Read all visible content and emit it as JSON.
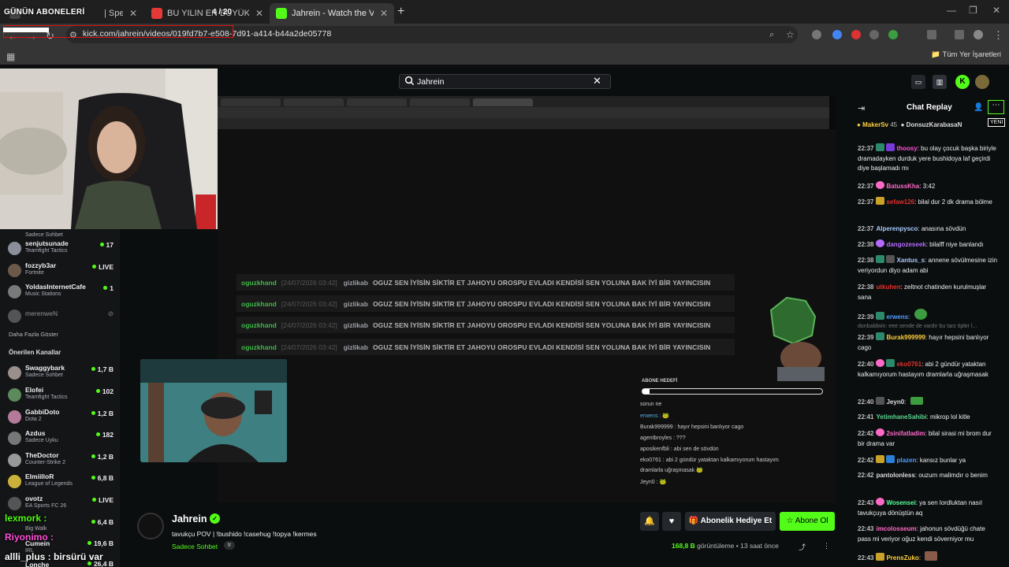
{
  "browser": {
    "tabs": [
      {
        "title": "| Special Dance",
        "active": false
      },
      {
        "title": "BU YILIN EN BÜYÜK DRAMASI",
        "active": false
      },
      {
        "title": "Jahrein - Watch the VOD on",
        "active": true
      }
    ],
    "url": "kick.com/jahrein/videos/019fd7b7-e508-7d91-a414-b44a2de05778",
    "bookmarks_all": "Tüm Yer İşaretleri"
  },
  "overlay": {
    "title": "GÜNÜN ABONELERİ",
    "counter": "4 / 20"
  },
  "search": {
    "value": "Jahrein"
  },
  "sidebar": {
    "followed": [
      {
        "name": "",
        "category": "Sadece Sohbet",
        "count": ""
      },
      {
        "name": "senjutsunade",
        "category": "Teamfight Tactics",
        "count": "17"
      },
      {
        "name": "fozzyb3ar",
        "category": "Fortnite",
        "count": "LIVE"
      },
      {
        "name": "YoldasInternetCafe",
        "category": "Music Stations",
        "count": "1"
      },
      {
        "name": "merenweN",
        "category": "",
        "count": ""
      }
    ],
    "show_more": "Daha Fazla Göster",
    "recommended_heading": "Önerilen Kanallar",
    "recommended": [
      {
        "name": "Swaggybark",
        "category": "Sadece Sohbet",
        "count": "1,7 B"
      },
      {
        "name": "Elofei",
        "category": "Teamfight Tactics",
        "count": "102"
      },
      {
        "name": "GabbiDoto",
        "category": "Dota 2",
        "count": "1,2 B"
      },
      {
        "name": "Azdus",
        "category": "Sadece Uyku",
        "count": "182"
      },
      {
        "name": "TheDoctor",
        "category": "Counter-Strike 2",
        "count": "1,2 B"
      },
      {
        "name": "ElmiilloR",
        "category": "League of Legends",
        "count": "6,8 B"
      },
      {
        "name": "ovotz",
        "category": "EA Sports FC 26",
        "count": "LIVE"
      },
      {
        "name": "",
        "category": "Big Walk",
        "count": "6,4 B"
      },
      {
        "name": "Cumein",
        "category": "IRL",
        "count": "19,6 B"
      },
      {
        "name": "Lonche",
        "category": "",
        "count": "26,4 B"
      }
    ]
  },
  "video": {
    "repeated_messages": [
      {
        "user": "oguzkhand",
        "time": "[24/07/2026 03:42]",
        "author": "gizlikab",
        "text": "OGUZ SEN İYİSİN SİKTİR ET JAHOYU OROSPU EVLADI KENDİSİ SEN YOLUNA BAK İYİ BİR YAYINCISIN"
      },
      {
        "user": "oguzkhand",
        "time": "[24/07/2026 03:42]",
        "author": "gizlikab",
        "text": "OGUZ SEN İYİSİN SİKTİR ET JAHOYU OROSPU EVLADI KENDİSİ SEN YOLUNA BAK İYİ BİR YAYINCISIN"
      },
      {
        "user": "oguzkhand",
        "time": "[24/07/2026 03:42]",
        "author": "gizlikab",
        "text": "OGUZ SEN İYİSİN SİKTİR ET JAHOYU OROSPU EVLADI KENDİSİ SEN YOLUNA BAK İYİ BİR YAYINCISIN"
      },
      {
        "user": "oguzkhand",
        "time": "[24/07/2026 03:42]",
        "author": "gizlikab",
        "text": "OGUZ SEN İYİSİN SİKTİR ET JAHOYU OROSPU EVLADI KENDİSİ SEN YOLUNA BAK İYİ BİR YAYINCISIN"
      }
    ],
    "sub_goal_label": "ABONE HEDEFİ",
    "sub_goal_progress": 0.04,
    "inner_chat": [
      "sorun ne",
      "erwens : 🐸",
      "Burak999999 : hayır hepsini banlıyor cago",
      "agentbroyles : ???",
      "aposikenfbli : abi sen de sövdün",
      "eko0761 : abi 2 gündür yataktan kalkamıyorum hastayım",
      "dramlarla uğraşmasak 🐸",
      "Jeyn0 : 🐸"
    ]
  },
  "stream": {
    "channel": "Jahrein",
    "title": "tavukçu POV | !bushido !casehug !topya !kermes",
    "category": "Sadece Sohbet",
    "tag": "tr",
    "gift_label": "Abonelik Hediye Et",
    "subscribe_label": "Abone Ol",
    "viewers": "168,8 B",
    "viewers_label": "görüntüleme",
    "ago": "13 saat önce"
  },
  "overlay_chat": [
    {
      "text": "lexmork :"
    },
    {
      "text": "Riyonimo :"
    },
    {
      "text": "allli_plus : birsürü var"
    }
  ],
  "chat": {
    "title": "Chat Replay",
    "new_label": "YENİ",
    "pinned": [
      {
        "name": "MakerSv",
        "count": "45"
      },
      {
        "name": "DonsuzKarabasaN",
        "count": ""
      }
    ],
    "messages": [
      {
        "time": "22:37",
        "user": "thoosy",
        "color": "#ff4fd8",
        "text": "bu olay çocuk başka biriyle dramadayken durduk yere bushidoya laf geçirdi diye başlamadı mı"
      },
      {
        "time": "22:37",
        "user": "BatussKha",
        "color": "#ff69c8",
        "text": "3:42"
      },
      {
        "time": "22:37",
        "user": "sefaw126",
        "color": "#e0312c",
        "text": "bilal dur 2 dk drama bölme"
      },
      {
        "time": "22:37",
        "user": "Alperenpysco",
        "color": "#a9c9ff",
        "text": "anasına sövdün"
      },
      {
        "time": "22:38",
        "user": "dangozeseek",
        "color": "#b46bff",
        "text": "bilalff niye banlandı"
      },
      {
        "time": "22:38",
        "user": "Xantus_s",
        "color": "#a9c9ff",
        "text": "annene sövülmesine izin veriyordun diyo adam abi"
      },
      {
        "time": "22:38",
        "user": "utkuhen",
        "color": "#e0312c",
        "text": "zeltnot chatinden kurulmuşlar sana"
      },
      {
        "time": "22:39",
        "user": "erwens",
        "color": "#4d9fff",
        "text": ""
      },
      {
        "time": "22:39",
        "user": "Burak999999",
        "color": "#ffcf3d",
        "text": "hayır hepsini banlıyor cago"
      },
      {
        "time": "22:40",
        "user": "eko0761",
        "color": "#e0312c",
        "text": "abi 2 gündür yataktan kalkamıyorum hastayım dramlarla uğraşmasak"
      },
      {
        "time": "22:40",
        "user": "Jeyn0",
        "color": "#dcdcdc",
        "text": ""
      },
      {
        "time": "22:41",
        "user": "YetimhaneSahibi",
        "color": "#58d68d",
        "text": "mikrop lol kitle"
      },
      {
        "time": "22:42",
        "user": "2sinifatladim",
        "color": "#ff69c8",
        "text": "bilal sirasi mi brom dur bir drama var"
      },
      {
        "time": "22:42",
        "user": "plazen",
        "color": "#4d9fff",
        "text": "kansız bunlar ya"
      },
      {
        "time": "22:42",
        "user": "pantolonless",
        "color": "#dcdcdc",
        "text": "ouzum malimdır o benim"
      },
      {
        "time": "22:43",
        "user": "Wosensei",
        "color": "#58ff9a",
        "text": "ya sen lordluktan nasıl tavukçuya dönüştün aq"
      },
      {
        "time": "22:43",
        "user": "imcolosseum",
        "color": "#ff69c8",
        "text": "jahonun sövdüğü chate pass mi veriyor oğuz kendi söverniyor mu"
      },
      {
        "time": "22:43",
        "user": "PrensZuko",
        "color": "#ffcf3d",
        "text": ""
      }
    ],
    "faint_line": "donbaldwin: eee sende de vardır bu tarz tipler l..."
  }
}
